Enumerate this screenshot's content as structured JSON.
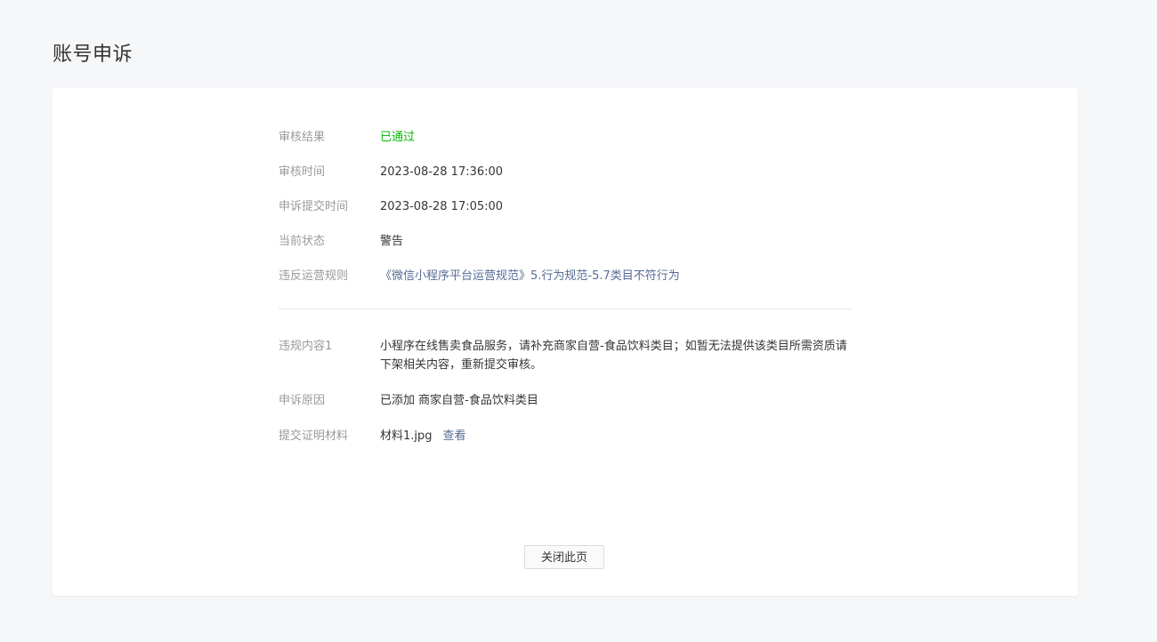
{
  "page": {
    "title": "账号申诉"
  },
  "details": {
    "review_result": {
      "label": "审核结果",
      "value": "已通过"
    },
    "review_time": {
      "label": "审核时间",
      "value": "2023-08-28 17:36:00"
    },
    "submit_time": {
      "label": "申诉提交时间",
      "value": "2023-08-28 17:05:00"
    },
    "current_status": {
      "label": "当前状态",
      "value": "警告"
    },
    "violated_rule": {
      "label": "违反运营规则",
      "value": "《微信小程序平台运营规范》5.行为规范-5.7类目不符行为"
    },
    "violation_content": {
      "label": "违规内容1",
      "value": "小程序在线售卖食品服务，请补充商家自营-食品饮料类目；如暂无法提供该类目所需资质请下架相关内容，重新提交审核。"
    },
    "appeal_reason": {
      "label": "申诉原因",
      "value": "已添加 商家自营-食品饮料类目"
    },
    "proof_material": {
      "label": "提交证明材料",
      "file": "材料1.jpg",
      "view_label": "查看"
    }
  },
  "actions": {
    "close_label": "关闭此页"
  },
  "colors": {
    "success": "#09bb07",
    "link": "#576b95",
    "label": "#9a9a9a"
  }
}
